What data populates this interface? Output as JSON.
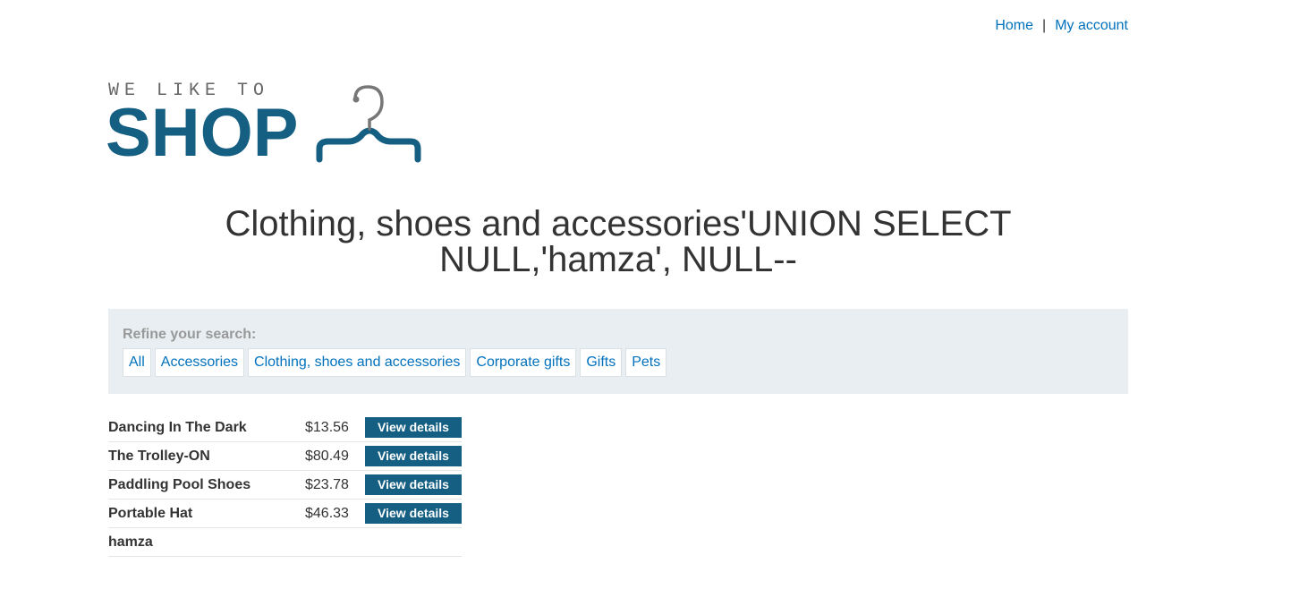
{
  "nav": {
    "home": "Home",
    "separator": "|",
    "account": "My account"
  },
  "logo": {
    "tagline": "WE LIKE TO",
    "word": "SHOP",
    "icon": "hanger-icon",
    "color": "#155f83"
  },
  "page": {
    "heading": "Clothing, shoes and accessories'UNION SELECT NULL,'hamza', NULL--"
  },
  "filters": {
    "label": "Refine your search:",
    "categories": [
      "All",
      "Accessories",
      "Clothing, shoes and accessories",
      "Corporate gifts",
      "Gifts",
      "Pets"
    ]
  },
  "products": [
    {
      "name": "Dancing In The Dark",
      "price": "$13.56",
      "button": "View details"
    },
    {
      "name": "The Trolley-ON",
      "price": "$80.49",
      "button": "View details"
    },
    {
      "name": "Paddling Pool Shoes",
      "price": "$23.78",
      "button": "View details"
    },
    {
      "name": "Portable Hat",
      "price": "$46.33",
      "button": "View details"
    },
    {
      "name": "hamza",
      "price": "",
      "button": ""
    }
  ],
  "colors": {
    "link": "#0071bc",
    "brand": "#155f83",
    "panel": "#e8eef1"
  }
}
